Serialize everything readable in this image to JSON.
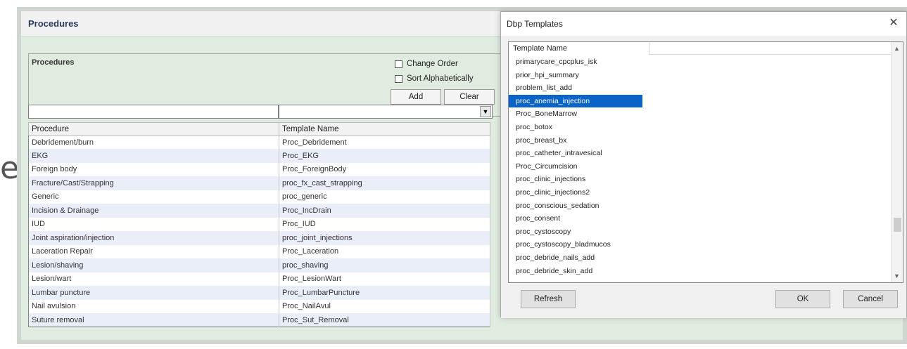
{
  "background": {
    "partial_letter": "e"
  },
  "procedures_window": {
    "title": "Procedures",
    "group_label": "Procedures",
    "change_order_label": "Change Order",
    "sort_alpha_label": "Sort Alphabetically",
    "add_label": "Add",
    "clear_label": "Clear",
    "procedure_filter_value": "",
    "template_filter_value": "",
    "table": {
      "columns": [
        "Procedure",
        "Template Name"
      ],
      "rows": [
        [
          "Debridement/burn",
          "Proc_Debridement"
        ],
        [
          "EKG",
          "Proc_EKG"
        ],
        [
          "Foreign body",
          "Proc_ForeignBody"
        ],
        [
          "Fracture/Cast/Strapping",
          "proc_fx_cast_strapping"
        ],
        [
          "Generic",
          "proc_generic"
        ],
        [
          "Incision & Drainage",
          "Proc_IncDrain"
        ],
        [
          "IUD",
          "Proc_IUD"
        ],
        [
          "Joint aspiration/injection",
          "proc_joint_injections"
        ],
        [
          "Laceration Repair",
          "Proc_Laceration"
        ],
        [
          "Lesion/shaving",
          "proc_shaving"
        ],
        [
          "Lesion/wart",
          "Proc_LesionWart"
        ],
        [
          "Lumbar puncture",
          "Proc_LumbarPuncture"
        ],
        [
          "Nail avulsion",
          "Proc_NailAvul"
        ],
        [
          "Suture removal",
          "Proc_Sut_Removal"
        ]
      ]
    }
  },
  "dbp_dialog": {
    "title": "Dbp Templates",
    "list_header": "Template Name",
    "selected_index": 3,
    "items": [
      "primarycare_cpcplus_isk",
      "prior_hpi_summary",
      "problem_list_add",
      "proc_anemia_injection",
      "Proc_BoneMarrow",
      "proc_botox",
      "proc_breast_bx",
      "proc_catheter_intravesical",
      "Proc_Circumcision",
      "proc_clinic_injections",
      "proc_clinic_injections2",
      "proc_conscious_sedation",
      "proc_consent",
      "proc_cystoscopy",
      "proc_cystoscopy_bladmucos",
      "proc_debride_nails_add",
      "proc_debride_skin_add"
    ],
    "refresh_label": "Refresh",
    "ok_label": "OK",
    "cancel_label": "Cancel"
  },
  "colors": {
    "selection": "#0a64c8",
    "window_bg": "#e1ece1",
    "title_text": "#2e3a60"
  }
}
